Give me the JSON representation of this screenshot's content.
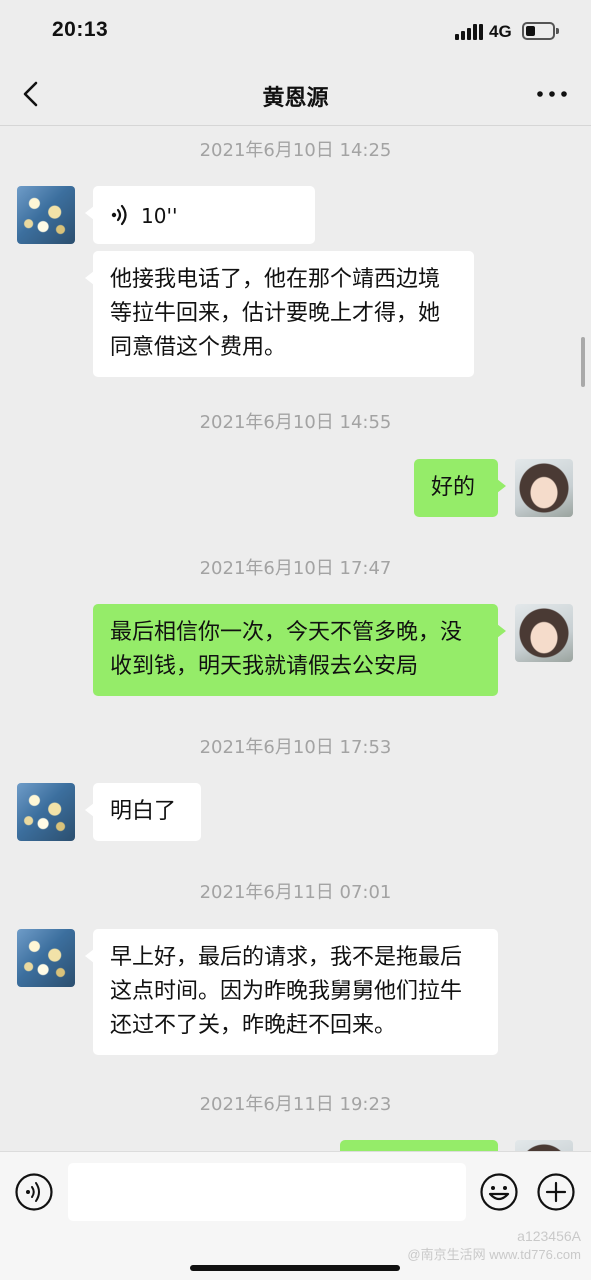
{
  "status_bar": {
    "time": "20:13",
    "network": "4G"
  },
  "header": {
    "title": "黄恩源",
    "back_icon": "chevron-left-icon",
    "more_icon": "more-dots-icon"
  },
  "messages": {
    "ts1": "2021年6月10日 14:25",
    "m1_voice_duration": "10''",
    "m2_text": "他接我电话了，他在那个靖西边境等拉牛回来，估计要晚上才得，她同意借这个费用。",
    "ts2": "2021年6月10日 14:55",
    "m3_text": "好的",
    "ts3": "2021年6月10日 17:47",
    "m4_text": "最后相信你一次，今天不管多晚，没收到钱，明天我就请假去公安局",
    "ts4": "2021年6月10日 17:53",
    "m5_text": "明白了",
    "ts5": "2021年6月11日 07:01",
    "m6_text": "早上好，最后的请求，我不是拖最后这点时间。因为昨晚我舅舅他们拉牛还过不了关，昨晚赶不回来。",
    "ts6": "2021年6月11日 19:23"
  },
  "input_bar": {
    "placeholder": "",
    "voice_icon": "voice-mode-icon",
    "emoji_icon": "emoji-icon",
    "plus_icon": "plus-icon"
  },
  "watermark": {
    "line1": "a123456A",
    "line2": "@南京生活网 www.td776.com"
  },
  "colors": {
    "background": "#ededed",
    "incoming_bubble": "#ffffff",
    "outgoing_bubble": "#95ec69",
    "timestamp": "#a3a3a3"
  }
}
